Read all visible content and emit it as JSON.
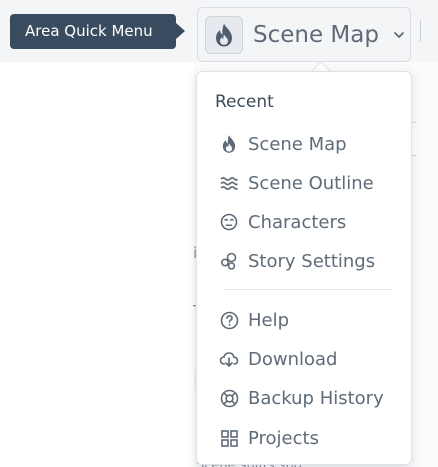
{
  "tooltip": {
    "text": "Area Quick Menu"
  },
  "area_trigger": {
    "label": "Scene Map",
    "icon": "flame-icon",
    "chevron": "chevron-down-icon"
  },
  "menu": {
    "section_title": "Recent",
    "recent_items": [
      {
        "label": "Scene Map",
        "icon": "flame-icon"
      },
      {
        "label": "Scene Outline",
        "icon": "waves-icon"
      },
      {
        "label": "Characters",
        "icon": "face-icon"
      },
      {
        "label": "Story Settings",
        "icon": "bubbles-icon"
      }
    ],
    "other_items": [
      {
        "label": "Help",
        "icon": "help-circle-icon"
      },
      {
        "label": "Download",
        "icon": "cloud-download-icon"
      },
      {
        "label": "Backup History",
        "icon": "lifebuoy-icon"
      },
      {
        "label": "Projects",
        "icon": "grid-icon"
      }
    ]
  },
  "background": {
    "partial_text": "Scene shifts sho..."
  },
  "colors": {
    "tooltip_bg": "#394b5f",
    "text": "#5f6b78",
    "heading": "#3c4a5a",
    "trigger_bg": "#f4f5f7"
  }
}
